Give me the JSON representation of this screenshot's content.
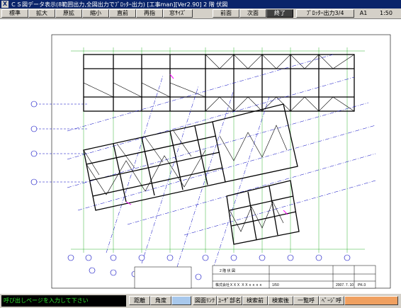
{
  "window": {
    "title": "ＣＳ図データ表示(8範囲出力,全図出力でﾌﾟﾛｯﾀｰ出力) [工事man][Ver2.90] 2 階 伏図"
  },
  "toolbar": {
    "standard": "標準",
    "zoom_in": "拡大",
    "original": "原拡",
    "zoom_out": "縮小",
    "previous_view": "直前",
    "redraw": "再指",
    "window_size": "窓ｻｲｽﾞ",
    "prev_page": "前面",
    "next_page": "次面",
    "exit": "終了",
    "plotter_output": "ﾌﾟﾛｯﾀｰ出力3/4",
    "paper_size": "A1",
    "scale": "1:50"
  },
  "statusbar": {
    "prompt": "呼び出しページを入力して下さい",
    "distance": "距離",
    "angle": "角度",
    "drawing_link": "図面ﾘﾝｸ",
    "user_part_name": "ﾕｰｻﾞ部名",
    "search_prev": "検索前",
    "search_next": "検索後",
    "list_view": "一覧呼",
    "page_call": "ﾍﾟｰｼﾞ呼"
  },
  "drawing": {
    "colors": {
      "structure": "#000000",
      "dimension": "#00a000",
      "grid": "#0000c0",
      "highlight": "#ff00ff"
    },
    "upper_grid_labels": [
      "①",
      "②",
      "③",
      "④",
      "⑤",
      "⑥",
      "⑦",
      "⑧",
      "⑨",
      "⑩"
    ],
    "lower_grid_labels": [
      "⑬",
      "⑫",
      "⑪",
      "⑩",
      "⑨",
      "⑧",
      "⑦",
      "⑥",
      "⑤",
      "④",
      "③",
      "②",
      "①"
    ],
    "title_block": {
      "heading": "2 階 伏 図",
      "client": "株式会社ＸＸＸ ＸＸｘｘｘｘ",
      "scale": "1/50",
      "date": "2007. 7. 10",
      "sheet": "PK-3"
    }
  }
}
